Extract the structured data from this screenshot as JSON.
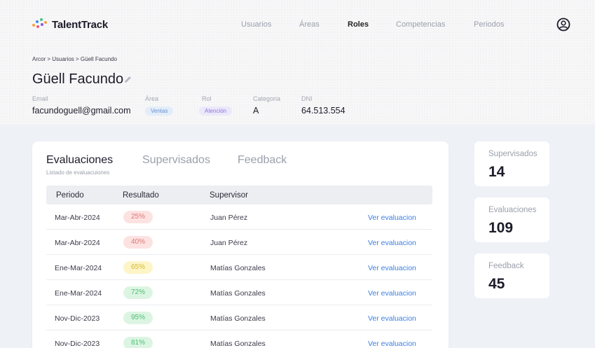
{
  "app": {
    "name": "TalentTrack"
  },
  "nav": {
    "items": [
      {
        "label": "Usuarios"
      },
      {
        "label": "Áreas"
      },
      {
        "label": "Roles"
      },
      {
        "label": "Competencias"
      },
      {
        "label": "Periodos"
      }
    ],
    "active": "Roles"
  },
  "breadcrumb": "Arcor > Usuarios > Güell Facundo",
  "user": {
    "name": "Güell Facundo",
    "email_label": "Email",
    "email": "facundoguell@gmail.com",
    "area_label": "Área",
    "area": "Ventas",
    "rol_label": "Rol",
    "rol": "Atención",
    "categoria_label": "Categoria",
    "categoria": "A",
    "dni_label": "DNI",
    "dni": "64.513.554"
  },
  "tabs": {
    "evaluaciones": "Evaluaciones",
    "supervisados": "Supervisados",
    "feedback": "Feedback",
    "subtitle": "Listado de evaluacuiones"
  },
  "table": {
    "headers": {
      "periodo": "Periodo",
      "resultado": "Resultado",
      "supervisor": "Supervisor"
    },
    "rows": [
      {
        "periodo": "Mar-Abr-2024",
        "resultado": "25%",
        "supervisor": "Juan Pérez",
        "link": "Ver evaluacion"
      },
      {
        "periodo": "Mar-Abr-2024",
        "resultado": "40%",
        "supervisor": "Juan Pérez",
        "link": "Ver evaluacion"
      },
      {
        "periodo": "Ene-Mar-2024",
        "resultado": "65%",
        "supervisor": "Matías Gonzales",
        "link": "Ver evaluacion"
      },
      {
        "periodo": "Ene-Mar-2024",
        "resultado": "72%",
        "supervisor": "Matías Gonzales",
        "link": "Ver evaluacion"
      },
      {
        "periodo": "Nov-Dic-2023",
        "resultado": "95%",
        "supervisor": "Matías Gonzales",
        "link": "Ver evaluacion"
      },
      {
        "periodo": "Nov-Dic-2023",
        "resultado": "81%",
        "supervisor": "Matías Gonzales",
        "link": "Ver evaluacion"
      }
    ]
  },
  "stats": [
    {
      "label": "Supervisados",
      "value": "14"
    },
    {
      "label": "Evaluaciones",
      "value": "109"
    },
    {
      "label": "Feedback",
      "value": "45"
    }
  ],
  "colors": {
    "accent_link": "#3d7fe0",
    "badge_low_bg": "#fde2e2",
    "badge_low_text": "#e07474",
    "badge_mid_bg": "#fdf5c8",
    "badge_mid_text": "#d4b92c",
    "badge_high_bg": "#dcf5e3",
    "badge_high_text": "#4cbf72"
  }
}
